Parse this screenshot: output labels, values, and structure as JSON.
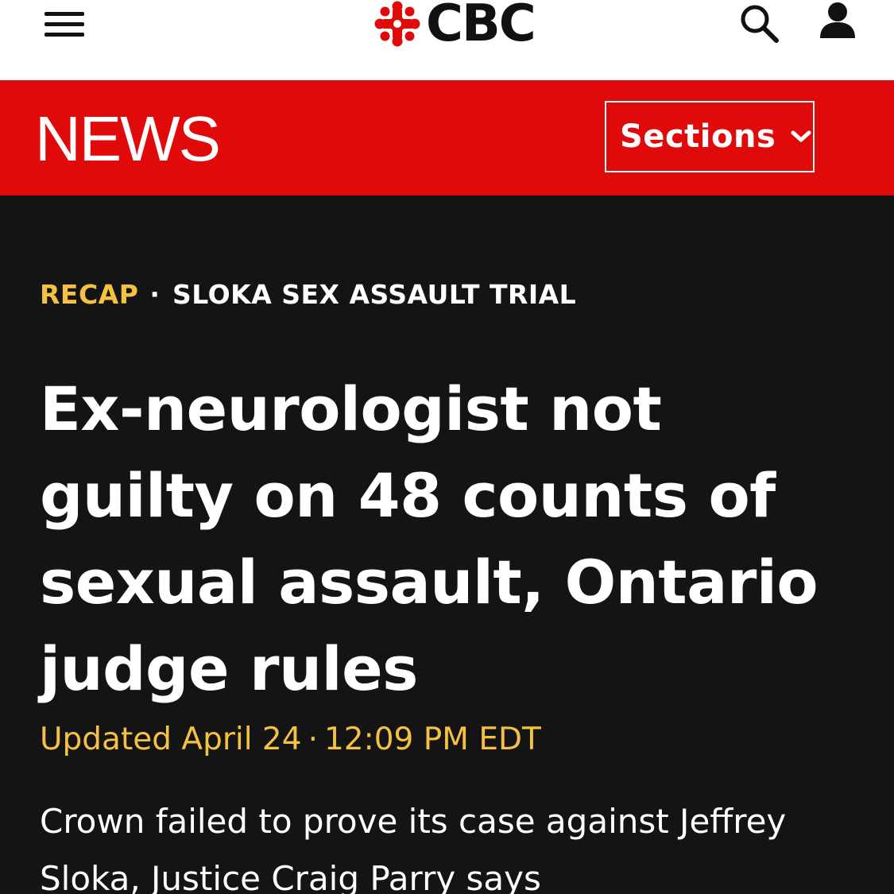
{
  "header": {
    "logo_text": "CBC",
    "menu_icon": "hamburger-menu-icon",
    "search_icon": "search-icon",
    "account_icon": "account-icon",
    "logo_color": "#e00a0a"
  },
  "newsbar": {
    "title": "NEWS",
    "sections_label": "Sections",
    "background": "#e00a0a"
  },
  "article": {
    "kicker_label": "RECAP",
    "kicker_separator": "·",
    "kicker_topic": "SLOKA SEX ASSAULT TRIAL",
    "headline": "Ex-neurologist not guilty on 48 counts of sexual assault, Ontario judge rules",
    "updated_label": "Updated April 24",
    "updated_separator": "·",
    "updated_time": "12:09 PM EDT",
    "dek": "Crown failed to prove its case against Jeffrey Sloka, Justice Craig Parry says",
    "accent_color": "#f5c141",
    "background": "#141414"
  }
}
